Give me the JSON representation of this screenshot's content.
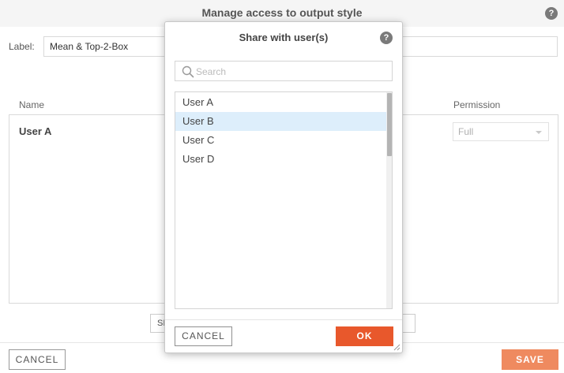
{
  "background_dialog": {
    "title": "Manage access to output style",
    "help_glyph": "?",
    "label_caption": "Label:",
    "label_value": "Mean & Top-2-Box",
    "columns": {
      "name": "Name",
      "permission": "Permission"
    },
    "rows": [
      {
        "name": "User A",
        "permission": "Full"
      }
    ],
    "share_button_partial": "SI",
    "cancel_label": "CANCEL",
    "save_label": "SAVE"
  },
  "modal": {
    "title": "Share with user(s)",
    "help_glyph": "?",
    "search": {
      "placeholder": "Search",
      "value": ""
    },
    "users": [
      "User A",
      "User B",
      "User C",
      "User D"
    ],
    "selected_user": "User B",
    "cancel_label": "CANCEL",
    "ok_label": "OK"
  },
  "colors": {
    "accent_ok": "#e8582c",
    "accent_save": "#ef8a5f",
    "selection": "#ddeefb"
  },
  "icons": [
    "help-icon",
    "search-icon",
    "chevron-down-icon",
    "resize-grip-icon"
  ]
}
